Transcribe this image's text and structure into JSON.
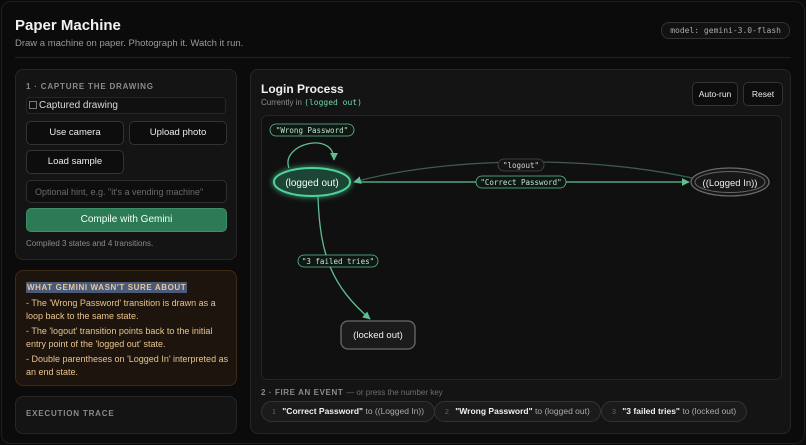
{
  "header": {
    "title": "Paper Machine",
    "subtitle": "Draw a machine on paper. Photograph it. Watch it run.",
    "model_badge": "model: gemini-3.0-flash"
  },
  "capture": {
    "section_label": "1 · CAPTURE THE DRAWING",
    "image_alt": "Captured drawing",
    "use_camera_label": "Use camera",
    "upload_label": "Upload photo",
    "sample_label": "Load sample",
    "hint_value": "",
    "hint_placeholder": "Optional hint, e.g. \"it's a vending machine\"",
    "compile_label": "Compile with Gemini",
    "status": "Compiled 3 states and 4 transitions."
  },
  "unsure": {
    "title": "WHAT GEMINI WASN'T SURE ABOUT",
    "items": [
      "- The 'Wrong Password' transition is drawn as a loop back to the same state.",
      "- The 'logout' transition points back to the initial entry point of the 'logged out' state.",
      "- Double parentheses on 'Logged In' interpreted as an end state."
    ]
  },
  "trace": {
    "section_label": "EXECUTION TRACE"
  },
  "machine": {
    "title": "Login Process",
    "current_prefix": "Currently in",
    "current_state": "(logged out)",
    "autorun_label": "Auto-run",
    "reset_label": "Reset",
    "colors": {
      "accent": "#4fd39a",
      "edge": "#5fbf92",
      "node_active_fill": "#1a4534"
    },
    "diagram": {
      "states": [
        {
          "id": "logged_out",
          "label": "(logged out)",
          "active": true
        },
        {
          "id": "logged_in",
          "label": "((Logged In))",
          "final": true
        },
        {
          "id": "locked_out",
          "label": "(locked out)"
        }
      ],
      "transitions": [
        {
          "label": "\"Wrong Password\""
        },
        {
          "label": "\"logout\""
        },
        {
          "label": "\"Correct Password\""
        },
        {
          "label": "\"3 failed tries\""
        }
      ]
    }
  },
  "fire": {
    "label": "2 · FIRE AN EVENT",
    "hint": "— or press the number key",
    "events": [
      {
        "num": "1",
        "name": "\"Correct Password\"",
        "target": "to ((Logged In))"
      },
      {
        "num": "2",
        "name": "\"Wrong Password\"",
        "target": "to (logged out)"
      },
      {
        "num": "3",
        "name": "\"3 failed tries\"",
        "target": "to (locked out)"
      }
    ]
  }
}
